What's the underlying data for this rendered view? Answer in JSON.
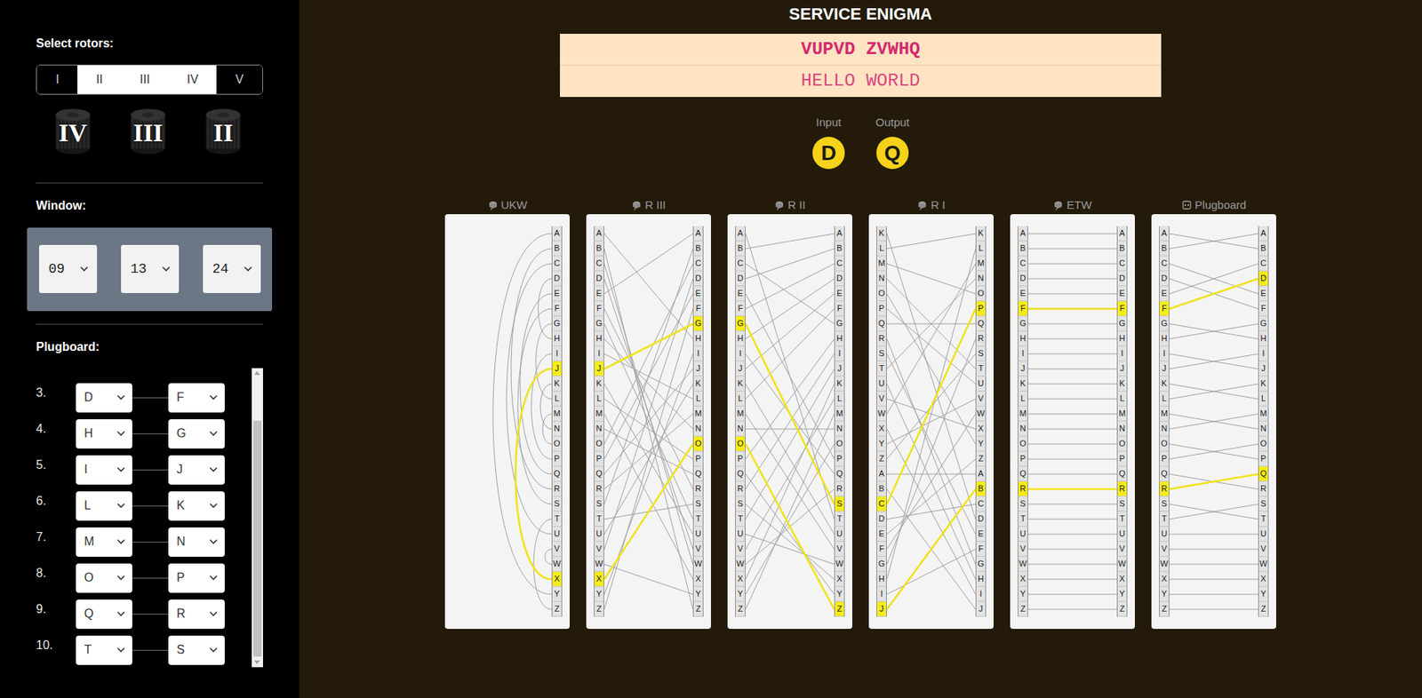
{
  "title": "SERVICE ENIGMA",
  "sidebar": {
    "rotor_label": "Select rotors:",
    "rotor_choices": [
      {
        "label": "I",
        "selected": false
      },
      {
        "label": "II",
        "selected": true
      },
      {
        "label": "III",
        "selected": true
      },
      {
        "label": "IV",
        "selected": true
      },
      {
        "label": "V",
        "selected": false
      }
    ],
    "rotor_slots": [
      "IV",
      "III",
      "II"
    ],
    "window_label": "Window:",
    "window": [
      "09",
      "13",
      "24"
    ],
    "plugboard_label": "Plugboard:",
    "plugboard": [
      {
        "index": "3.",
        "a": "D",
        "b": "F"
      },
      {
        "index": "4.",
        "a": "H",
        "b": "G"
      },
      {
        "index": "5.",
        "a": "I",
        "b": "J"
      },
      {
        "index": "6.",
        "a": "L",
        "b": "K"
      },
      {
        "index": "7.",
        "a": "M",
        "b": "N"
      },
      {
        "index": "8.",
        "a": "O",
        "b": "P"
      },
      {
        "index": "9.",
        "a": "Q",
        "b": "R"
      },
      {
        "index": "10.",
        "a": "T",
        "b": "S"
      }
    ],
    "plugboard_scroll": {
      "level": 1,
      "visible_share": 0.85
    }
  },
  "message": {
    "cipher": "VUPVD ZVWHQ",
    "plain": "HELLO WORLD"
  },
  "io": {
    "input_label": "Input",
    "input": "D",
    "output_label": "Output",
    "output": "Q"
  },
  "panels": [
    {
      "label": "UKW",
      "kind": "reflector",
      "right": [
        "A",
        "B",
        "C",
        "D",
        "E",
        "F",
        "G",
        "H",
        "I",
        "J",
        "K",
        "L",
        "M",
        "N",
        "O",
        "P",
        "Q",
        "R",
        "S",
        "T",
        "U",
        "V",
        "W",
        "X",
        "Y",
        "Z"
      ],
      "links": [
        24,
        17,
        20,
        7,
        16,
        18,
        11,
        3,
        15,
        23,
        13,
        6,
        14,
        10,
        12,
        8,
        4,
        1,
        5,
        25,
        2,
        22,
        21,
        9,
        0,
        19
      ],
      "lit_right": [
        9,
        23
      ]
    },
    {
      "label": "R III",
      "kind": "rotor",
      "left": [
        "A",
        "B",
        "C",
        "D",
        "E",
        "F",
        "G",
        "H",
        "I",
        "J",
        "K",
        "L",
        "M",
        "N",
        "O",
        "P",
        "Q",
        "R",
        "S",
        "T",
        "U",
        "V",
        "W",
        "X",
        "Y",
        "Z"
      ],
      "right": [
        "A",
        "B",
        "C",
        "D",
        "E",
        "F",
        "G",
        "H",
        "I",
        "J",
        "K",
        "L",
        "M",
        "N",
        "O",
        "P",
        "Q",
        "R",
        "S",
        "T",
        "U",
        "V",
        "W",
        "X",
        "Y",
        "Z"
      ],
      "links": [
        4,
        18,
        14,
        21,
        15,
        25,
        9,
        0,
        24,
        16,
        20,
        8,
        17,
        7,
        23,
        11,
        13,
        5,
        19,
        6,
        10,
        3,
        2,
        12,
        22,
        1
      ],
      "lit_left": [
        9,
        23
      ],
      "lit_right": [
        6,
        14
      ]
    },
    {
      "label": "R II",
      "kind": "rotor",
      "left": [
        "A",
        "B",
        "C",
        "D",
        "E",
        "F",
        "G",
        "H",
        "I",
        "J",
        "K",
        "L",
        "M",
        "N",
        "O",
        "P",
        "Q",
        "R",
        "S",
        "T",
        "U",
        "V",
        "W",
        "X",
        "Y",
        "Z"
      ],
      "right": [
        "A",
        "B",
        "C",
        "D",
        "E",
        "F",
        "G",
        "H",
        "I",
        "J",
        "K",
        "L",
        "M",
        "N",
        "O",
        "P",
        "Q",
        "R",
        "S",
        "T",
        "U",
        "V",
        "W",
        "X",
        "Y",
        "Z"
      ],
      "links": [
        1,
        3,
        5,
        7,
        9,
        11,
        2,
        15,
        17,
        19,
        23,
        21,
        25,
        13,
        24,
        4,
        8,
        22,
        6,
        0,
        10,
        12,
        20,
        18,
        16,
        14
      ],
      "lit_left": [
        6,
        14
      ],
      "lit_right": [
        18,
        25
      ]
    },
    {
      "label": "R I",
      "kind": "rotor",
      "left": [
        "K",
        "L",
        "M",
        "N",
        "O",
        "P",
        "Q",
        "R",
        "S",
        "T",
        "U",
        "V",
        "W",
        "X",
        "Y",
        "Z",
        "A",
        "B",
        "C",
        "D",
        "E",
        "F",
        "G",
        "H",
        "I",
        "J"
      ],
      "right": [
        "K",
        "L",
        "M",
        "N",
        "O",
        "P",
        "Q",
        "R",
        "S",
        "T",
        "U",
        "V",
        "W",
        "X",
        "Y",
        "Z",
        "A",
        "B",
        "C",
        "D",
        "E",
        "F",
        "G",
        "H",
        "I",
        "J"
      ],
      "links": [
        1,
        23,
        12,
        9,
        2,
        18,
        6,
        22,
        15,
        3,
        5,
        14,
        21,
        11,
        4,
        20,
        16,
        25,
        19,
        0,
        8,
        24,
        7,
        10,
        13,
        17
      ],
      "lit_left": [
        18,
        25
      ],
      "lit_right": [
        5,
        17
      ]
    },
    {
      "label": "ETW",
      "kind": "rotor",
      "left": [
        "A",
        "B",
        "C",
        "D",
        "E",
        "F",
        "G",
        "H",
        "I",
        "J",
        "K",
        "L",
        "M",
        "N",
        "O",
        "P",
        "Q",
        "R",
        "S",
        "T",
        "U",
        "V",
        "W",
        "X",
        "Y",
        "Z"
      ],
      "right": [
        "A",
        "B",
        "C",
        "D",
        "E",
        "F",
        "G",
        "H",
        "I",
        "J",
        "K",
        "L",
        "M",
        "N",
        "O",
        "P",
        "Q",
        "R",
        "S",
        "T",
        "U",
        "V",
        "W",
        "X",
        "Y",
        "Z"
      ],
      "links": [
        0,
        1,
        2,
        3,
        4,
        5,
        6,
        7,
        8,
        9,
        10,
        11,
        12,
        13,
        14,
        15,
        16,
        17,
        18,
        19,
        20,
        21,
        22,
        23,
        24,
        25
      ],
      "lit_left": [
        5,
        17
      ],
      "lit_right": [
        5,
        17
      ]
    },
    {
      "label": "Plugboard",
      "kind": "plugboard",
      "left": [
        "A",
        "B",
        "C",
        "D",
        "E",
        "F",
        "G",
        "H",
        "I",
        "J",
        "K",
        "L",
        "M",
        "N",
        "O",
        "P",
        "Q",
        "R",
        "S",
        "T",
        "U",
        "V",
        "W",
        "X",
        "Y",
        "Z"
      ],
      "right": [
        "A",
        "B",
        "C",
        "D",
        "E",
        "F",
        "G",
        "H",
        "I",
        "J",
        "K",
        "L",
        "M",
        "N",
        "O",
        "P",
        "Q",
        "R",
        "S",
        "T",
        "U",
        "V",
        "W",
        "X",
        "Y",
        "Z"
      ],
      "links": [
        1,
        0,
        4,
        5,
        2,
        3,
        7,
        6,
        9,
        8,
        11,
        10,
        13,
        12,
        15,
        14,
        17,
        16,
        19,
        18,
        20,
        21,
        22,
        23,
        24,
        25
      ],
      "lit_left": [
        5,
        17
      ],
      "lit_right": [
        3,
        16
      ]
    }
  ]
}
